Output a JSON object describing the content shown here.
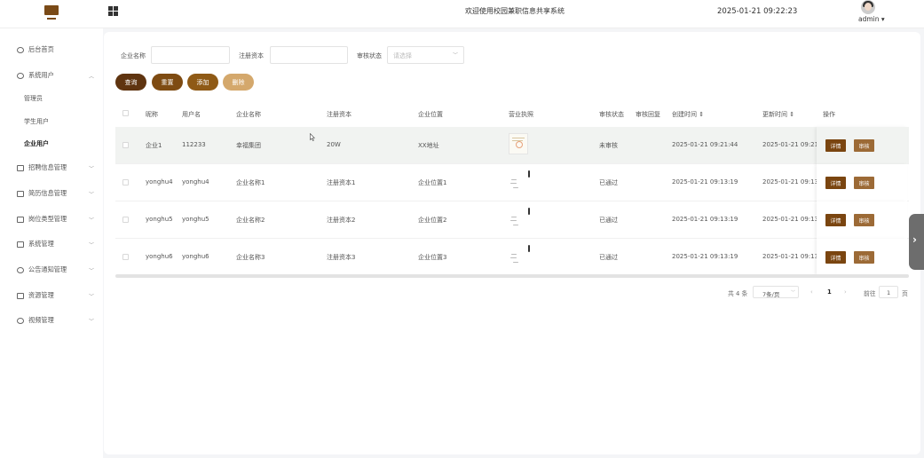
{
  "header": {
    "title": "欢迎使用校园兼职信息共享系统",
    "datetime": "2025-01-21 09:22:23",
    "user": "admin ▾"
  },
  "sidebar": {
    "items": [
      {
        "label": "后台首页",
        "icon": "clock-icon"
      },
      {
        "label": "系统用户",
        "icon": "user-icon",
        "expanded": true
      },
      {
        "label": "招聘信息管理",
        "icon": "list-icon"
      },
      {
        "label": "简历信息管理",
        "icon": "card-icon"
      },
      {
        "label": "岗位类型管理",
        "icon": "layers-icon"
      },
      {
        "label": "系统管理",
        "icon": "folder-icon"
      },
      {
        "label": "公告通知管理",
        "icon": "bell-icon"
      },
      {
        "label": "资源管理",
        "icon": "printer-icon"
      },
      {
        "label": "视频管理",
        "icon": "user-icon"
      }
    ],
    "subitems": [
      {
        "label": "管理员"
      },
      {
        "label": "学生用户"
      },
      {
        "label": "企业用户",
        "active": true
      }
    ]
  },
  "search": {
    "company_name_label": "企业名称",
    "capital_label": "注册资本",
    "status_label": "审核状态",
    "status_placeholder": "请选择"
  },
  "buttons": {
    "query": "查询",
    "reset": "重置",
    "add": "添加",
    "delete": "删除"
  },
  "colors": {
    "query": "#5f3410",
    "reset": "#7e4b12",
    "add": "#8f5a16",
    "delete": "#d4a86c",
    "detail": "#7a4510",
    "audit": "#9c6a36"
  },
  "table": {
    "headers": {
      "nickname": "昵称",
      "username": "用户名",
      "company": "企业名称",
      "capital": "注册资本",
      "location": "企业位置",
      "license": "营业执照",
      "status": "审核状态",
      "reply": "审核回复",
      "created": "创建时间 ⇕",
      "updated": "更新时间 ⇕",
      "actions": "操作"
    },
    "rows": [
      {
        "nickname": "企业1",
        "username": "112233",
        "company": "幸福集团",
        "capital": "20W",
        "location": "XX地址",
        "status": "未审核",
        "created": "2025-01-21 09:21:44",
        "updated": "2025-01-21 09:21:4"
      },
      {
        "nickname": "yonghu4",
        "username": "yonghu4",
        "company": "企业名称1",
        "capital": "注册资本1",
        "location": "企业位置1",
        "status": "已通过",
        "created": "2025-01-21 09:13:19",
        "updated": "2025-01-21 09:13:1"
      },
      {
        "nickname": "yonghu5",
        "username": "yonghu5",
        "company": "企业名称2",
        "capital": "注册资本2",
        "location": "企业位置2",
        "status": "已通过",
        "created": "2025-01-21 09:13:19",
        "updated": "2025-01-21 09:13:1"
      },
      {
        "nickname": "yonghu6",
        "username": "yonghu6",
        "company": "企业名称3",
        "capital": "注册资本3",
        "location": "企业位置3",
        "status": "已通过",
        "created": "2025-01-21 09:13:19",
        "updated": "2025-01-21 09:13:1"
      }
    ],
    "detail_label": "详情",
    "audit_label": "审核"
  },
  "pagination": {
    "total": "共 4 条",
    "page_size": "7条/页",
    "prev": "‹",
    "current": "1",
    "next": "›",
    "goto_label": "前往",
    "goto_value": "1",
    "page_unit": "页"
  }
}
